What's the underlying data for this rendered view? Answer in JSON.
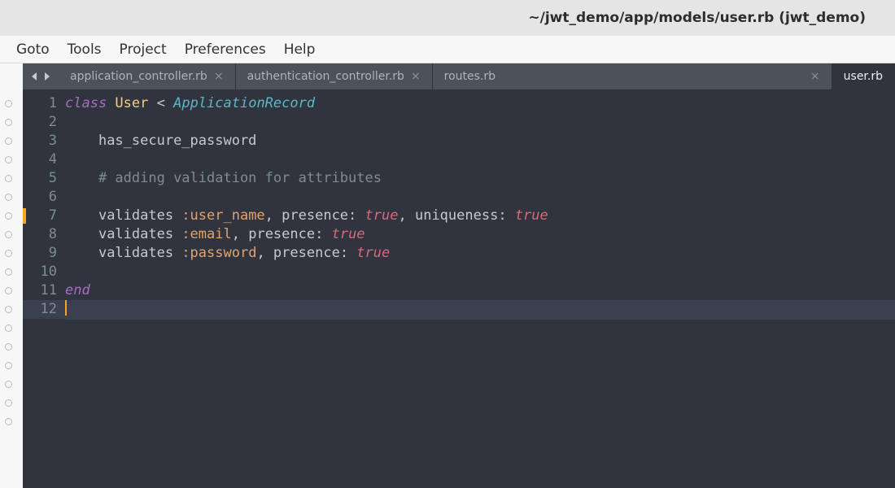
{
  "window": {
    "title": "~/jwt_demo/app/models/user.rb (jwt_demo)"
  },
  "menu": {
    "items": [
      "Goto",
      "Tools",
      "Project",
      "Preferences",
      "Help"
    ]
  },
  "tabs": [
    {
      "label": "application_controller.rb",
      "active": false,
      "closeable": true
    },
    {
      "label": "authentication_controller.rb",
      "active": false,
      "closeable": true
    },
    {
      "label": "routes.rb",
      "active": false,
      "closeable": true
    },
    {
      "label": "user.rb",
      "active": true,
      "closeable": false
    }
  ],
  "editor": {
    "cursor_line": 12,
    "lines": [
      {
        "n": 1,
        "modified": false,
        "tokens": [
          {
            "t": "class ",
            "c": "kw"
          },
          {
            "t": "User",
            "c": "cls"
          },
          {
            "t": " < ",
            "c": "id"
          },
          {
            "t": "ApplicationRecord",
            "c": "type"
          }
        ]
      },
      {
        "n": 2,
        "modified": false,
        "tokens": []
      },
      {
        "n": 3,
        "modified": false,
        "tokens": [
          {
            "t": "    ",
            "c": "id"
          },
          {
            "t": "has_secure_password",
            "c": "id"
          }
        ]
      },
      {
        "n": 4,
        "modified": false,
        "tokens": []
      },
      {
        "n": 5,
        "modified": false,
        "tokens": [
          {
            "t": "    ",
            "c": "id"
          },
          {
            "t": "# adding validation for attributes",
            "c": "cmt"
          }
        ]
      },
      {
        "n": 6,
        "modified": false,
        "tokens": []
      },
      {
        "n": 7,
        "modified": true,
        "tokens": [
          {
            "t": "    ",
            "c": "id"
          },
          {
            "t": "validates ",
            "c": "id"
          },
          {
            "t": ":user_name",
            "c": "sym"
          },
          {
            "t": ", ",
            "c": "id"
          },
          {
            "t": "presence",
            "c": "arg"
          },
          {
            "t": ": ",
            "c": "id"
          },
          {
            "t": "true",
            "c": "lit"
          },
          {
            "t": ", ",
            "c": "id"
          },
          {
            "t": "uniqueness",
            "c": "arg"
          },
          {
            "t": ": ",
            "c": "id"
          },
          {
            "t": "true",
            "c": "lit"
          }
        ]
      },
      {
        "n": 8,
        "modified": false,
        "tokens": [
          {
            "t": "    ",
            "c": "id"
          },
          {
            "t": "validates ",
            "c": "id"
          },
          {
            "t": ":email",
            "c": "sym"
          },
          {
            "t": ", ",
            "c": "id"
          },
          {
            "t": "presence",
            "c": "arg"
          },
          {
            "t": ": ",
            "c": "id"
          },
          {
            "t": "true",
            "c": "lit"
          }
        ]
      },
      {
        "n": 9,
        "modified": false,
        "tokens": [
          {
            "t": "    ",
            "c": "id"
          },
          {
            "t": "validates ",
            "c": "id"
          },
          {
            "t": ":password",
            "c": "sym"
          },
          {
            "t": ", ",
            "c": "id"
          },
          {
            "t": "presence",
            "c": "arg"
          },
          {
            "t": ": ",
            "c": "id"
          },
          {
            "t": "true",
            "c": "lit"
          }
        ]
      },
      {
        "n": 10,
        "modified": false,
        "tokens": []
      },
      {
        "n": 11,
        "modified": false,
        "tokens": [
          {
            "t": "end",
            "c": "kw"
          }
        ]
      },
      {
        "n": 12,
        "modified": false,
        "tokens": []
      }
    ]
  },
  "fold_dots": 18
}
